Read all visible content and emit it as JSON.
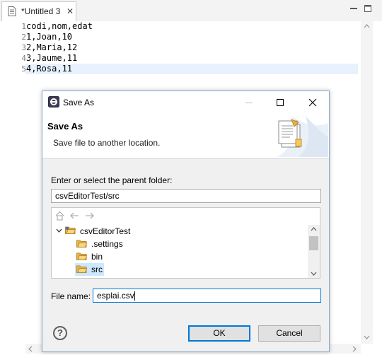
{
  "editor": {
    "tab_title": "*Untitled 3",
    "lines": [
      {
        "num": "1",
        "text": "codi,nom,edat"
      },
      {
        "num": "2",
        "text": "1,Joan,10"
      },
      {
        "num": "3",
        "text": "2,Maria,12"
      },
      {
        "num": "4",
        "text": "3,Jaume,11"
      },
      {
        "num": "5",
        "text": "4,Rosa,11"
      }
    ]
  },
  "dialog": {
    "title": "Save As",
    "banner_title": "Save As",
    "banner_description": "Save file to another location.",
    "folder_label": "Enter or select the parent folder:",
    "folder_value": "csvEditorTest/src",
    "tree": [
      {
        "label": "csvEditorTest",
        "expanded": true
      },
      {
        "label": ".settings"
      },
      {
        "label": "bin"
      },
      {
        "label": "src",
        "selected": true
      }
    ],
    "file_name_label": "File name:",
    "file_name_value": "esplai.csv",
    "ok_label": "OK",
    "cancel_label": "Cancel",
    "help_symbol": "?"
  },
  "colors": {
    "selection": "#cce8ff",
    "current_line": "#e8f2fe",
    "dialog_border": "#8aa7c9",
    "folder": "#e8b54a"
  }
}
